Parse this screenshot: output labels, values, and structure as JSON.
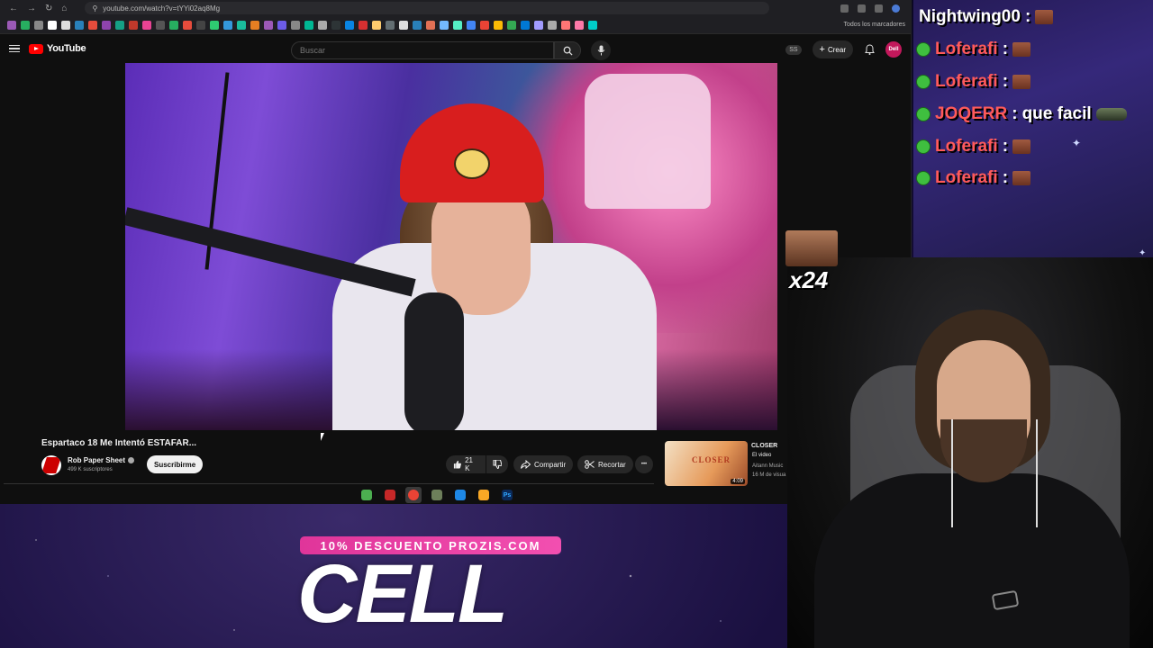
{
  "browser": {
    "url": "youtube.com/watch?v=tYYi02aq8Mg",
    "bookmarks_label": "Todos los marcadores"
  },
  "youtube": {
    "logo_text": "YouTube",
    "search_placeholder": "Buscar",
    "badge": "SS",
    "create_label": "Crear",
    "avatar_text": "Dell"
  },
  "video": {
    "title": "Espartaco 18 Me Intentó ESTAFAR...",
    "channel_name": "Rob Paper Sheet",
    "subscribers": "499 K suscriptores",
    "subscribe_label": "Suscribirme",
    "likes": "21 K",
    "share_label": "Compartir",
    "clip_label": "Recortar",
    "more_label": "•••"
  },
  "recommendation": {
    "thumb_text": "CLOSER",
    "title": "CLOSER",
    "subtitle": "El video",
    "channel": "Aitann Music",
    "views": "16 M de visua",
    "duration": "4:09"
  },
  "taskbar": {
    "apps": [
      {
        "name": "app-green",
        "color": "#4caf50"
      },
      {
        "name": "app-red",
        "color": "#c62828"
      },
      {
        "name": "app-chrome",
        "color": "#ea4335"
      },
      {
        "name": "app-3d",
        "color": "#6d7f5a"
      },
      {
        "name": "app-globe",
        "color": "#1e88e5"
      },
      {
        "name": "app-folder",
        "color": "#f9a825"
      },
      {
        "name": "app-photoshop",
        "color": "#0b2a5a",
        "label": "Ps"
      }
    ]
  },
  "chat": {
    "messages": [
      {
        "user": "Nightwing00",
        "message": "",
        "emote": "meme"
      },
      {
        "user": "Loferafi",
        "message": "",
        "emote": "meme"
      },
      {
        "user": "Loferafi",
        "message": "",
        "emote": "meme"
      },
      {
        "user": "JOQERR",
        "message": "que facil",
        "emote": "tank"
      },
      {
        "user": "Loferafi",
        "message": "",
        "emote": "meme"
      },
      {
        "user": "Loferafi",
        "message": "",
        "emote": "meme"
      }
    ],
    "separator": ":"
  },
  "overlay": {
    "emote_count": "x24",
    "promo_bar": "10% DESCUENTO PROZIS.COM",
    "promo_word": "CELL"
  }
}
